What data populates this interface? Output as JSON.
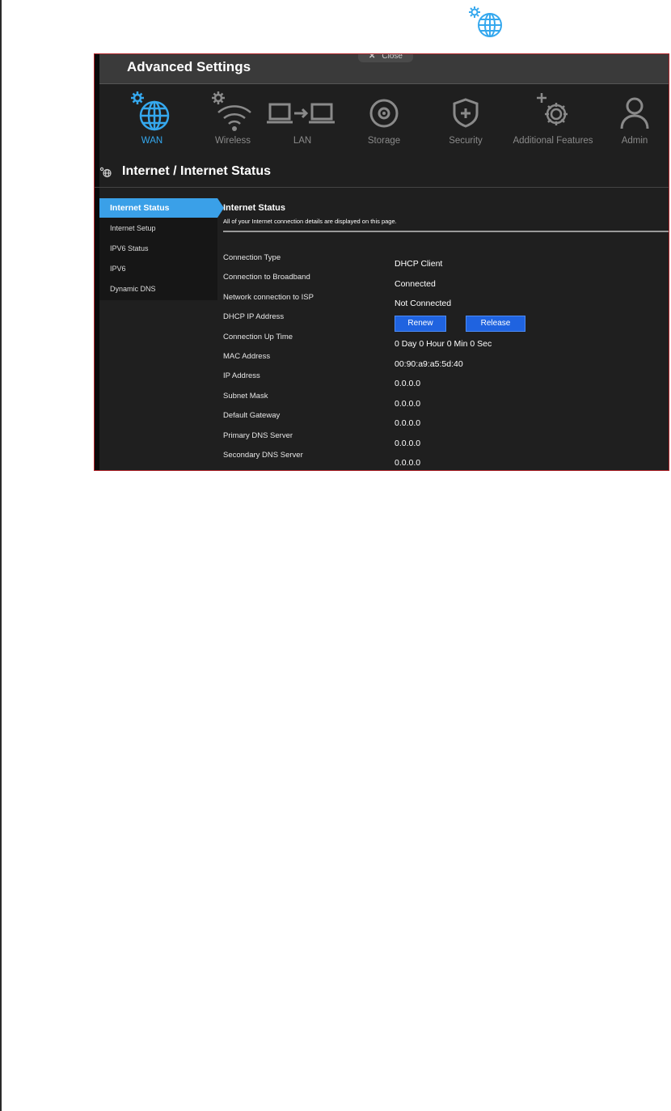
{
  "panel": {
    "title": "Advanced Settings",
    "close_label": "Close"
  },
  "nav": [
    {
      "label": "WAN",
      "icon": "globe-gear-icon",
      "active": true
    },
    {
      "label": "Wireless",
      "icon": "wifi-gear-icon",
      "active": false
    },
    {
      "label": "LAN",
      "icon": "lan-icon",
      "active": false
    },
    {
      "label": "Storage",
      "icon": "disc-icon",
      "active": false
    },
    {
      "label": "Security",
      "icon": "shield-icon",
      "active": false
    },
    {
      "label": "Additional Features",
      "icon": "gear-plus-icon",
      "active": false
    },
    {
      "label": "Admin",
      "icon": "user-icon",
      "active": false
    }
  ],
  "breadcrumb": "Internet / Internet Status",
  "sidebar": [
    {
      "label": "Internet Status",
      "active": true
    },
    {
      "label": "Internet Setup",
      "active": false
    },
    {
      "label": "IPV6 Status",
      "active": false
    },
    {
      "label": "IPV6",
      "active": false
    },
    {
      "label": "Dynamic DNS",
      "active": false
    }
  ],
  "content": {
    "title": "Internet Status",
    "description": "All of your Internet connection details are displayed on this page."
  },
  "fields": [
    {
      "label": "Connection Type",
      "value": "DHCP Client"
    },
    {
      "label": "Connection to Broadband",
      "value": "Connected"
    },
    {
      "label": "Network connection to ISP",
      "value": "Not Connected"
    },
    {
      "label": "DHCP IP Address",
      "value": ""
    },
    {
      "label": "Connection Up Time",
      "value": "0 Day 0 Hour 0 Min 0 Sec"
    },
    {
      "label": "MAC Address",
      "value": "00:90:a9:a5:5d:40"
    },
    {
      "label": "IP Address",
      "value": "0.0.0.0"
    },
    {
      "label": "Subnet Mask",
      "value": "0.0.0.0"
    },
    {
      "label": "Default Gateway",
      "value": "0.0.0.0"
    },
    {
      "label": "Primary DNS Server",
      "value": "0.0.0.0"
    },
    {
      "label": "Secondary DNS Server",
      "value": "0.0.0.0"
    }
  ],
  "buttons": {
    "renew": "Renew",
    "release": "Release"
  },
  "colors": {
    "accent": "#35a8ee",
    "button": "#1f63e0",
    "panel_border": "#b3262c"
  }
}
